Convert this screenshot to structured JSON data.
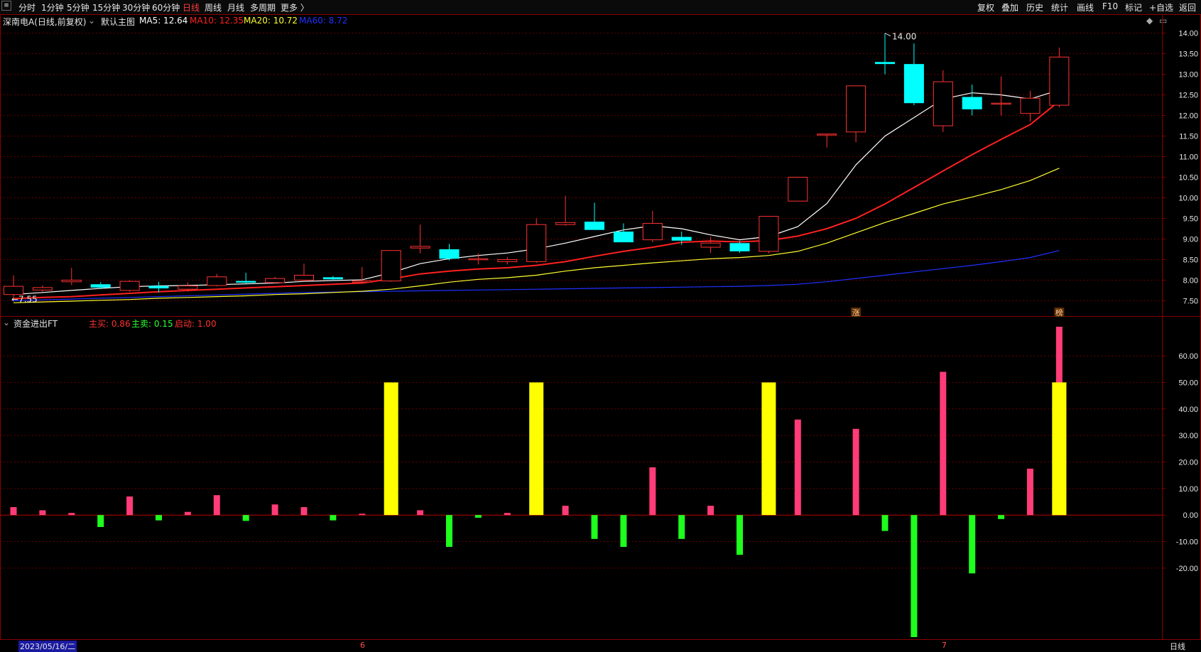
{
  "toolbar": {
    "left": [
      "分时",
      "1分钟",
      "5分钟",
      "15分钟",
      "30分钟",
      "60分钟",
      "日线",
      "周线",
      "月线",
      "多周期",
      "更多 〉"
    ],
    "active": "日线",
    "right": [
      "复权",
      "叠加",
      "历史",
      "统计",
      "画线",
      "F10",
      "标记",
      "+自选",
      "返回"
    ]
  },
  "price_panel": {
    "title": "深南电A(日线,前复权)",
    "main_indicator": "默认主图",
    "ma_labels": [
      {
        "name": "MA5",
        "text": "MA5: 12.64",
        "color": "#ffffff"
      },
      {
        "name": "MA10",
        "text": "MA10: 12.35",
        "color": "#ff2020"
      },
      {
        "name": "MA20",
        "text": "MA20: 10.72",
        "color": "#ffff30"
      },
      {
        "name": "MA60",
        "text": "MA60: 8.72",
        "color": "#2030ff"
      }
    ],
    "high_annotation": "14.00",
    "low_annotation": "←7.55",
    "badges": [
      "涨",
      "榜"
    ]
  },
  "indicator_panel": {
    "title": "资金进出FT",
    "labels": [
      {
        "text": "主买: 0.86",
        "color": "#ff3030"
      },
      {
        "text": "主卖: 0.15",
        "color": "#30ff30"
      },
      {
        "text": "启动: 1.00",
        "color": "#ff3030"
      }
    ]
  },
  "footer": {
    "date_label": "2023/05/16/二",
    "month_markers": [
      "6",
      "7"
    ],
    "period_label": "日线"
  },
  "colors": {
    "up": "#ff3232",
    "down": "#00ffff",
    "ma5": "#ffffff",
    "ma10": "#ff2020",
    "ma20": "#ffff30",
    "ma60": "#2030ff",
    "buy": "#ff3c78",
    "sell": "#1eff1e",
    "start": "#ffff00"
  },
  "chart_data": [
    {
      "type": "candlestick",
      "y_ticks": [
        7.5,
        8.0,
        8.5,
        9.0,
        9.5,
        10.0,
        10.5,
        11.0,
        11.5,
        12.0,
        12.5,
        13.0,
        13.5,
        14.0
      ],
      "ylim": [
        7.3,
        14.15
      ],
      "candles": [
        {
          "o": 7.65,
          "h": 8.12,
          "l": 7.58,
          "c": 7.85
        },
        {
          "o": 7.76,
          "h": 7.87,
          "l": 7.72,
          "c": 7.82
        },
        {
          "o": 7.96,
          "h": 8.3,
          "l": 7.88,
          "c": 8.0
        },
        {
          "o": 7.9,
          "h": 7.95,
          "l": 7.78,
          "c": 7.82
        },
        {
          "o": 7.75,
          "h": 8.0,
          "l": 7.72,
          "c": 7.97
        },
        {
          "o": 7.86,
          "h": 7.96,
          "l": 7.7,
          "c": 7.8
        },
        {
          "o": 7.78,
          "h": 7.95,
          "l": 7.72,
          "c": 7.86
        },
        {
          "o": 7.87,
          "h": 8.15,
          "l": 7.85,
          "c": 8.08
        },
        {
          "o": 7.98,
          "h": 8.18,
          "l": 7.9,
          "c": 7.94
        },
        {
          "o": 7.94,
          "h": 8.08,
          "l": 7.92,
          "c": 8.04
        },
        {
          "o": 8.0,
          "h": 8.4,
          "l": 7.97,
          "c": 8.12
        },
        {
          "o": 8.07,
          "h": 8.1,
          "l": 7.98,
          "c": 8.02
        },
        {
          "o": 7.95,
          "h": 8.32,
          "l": 7.93,
          "c": 7.98
        },
        {
          "o": 7.98,
          "h": 8.72,
          "l": 7.96,
          "c": 8.72
        },
        {
          "o": 8.78,
          "h": 9.35,
          "l": 8.65,
          "c": 8.82
        },
        {
          "o": 8.75,
          "h": 8.88,
          "l": 8.48,
          "c": 8.52
        },
        {
          "o": 8.52,
          "h": 8.65,
          "l": 8.38,
          "c": 8.52
        },
        {
          "o": 8.45,
          "h": 8.56,
          "l": 8.38,
          "c": 8.5
        },
        {
          "o": 8.45,
          "h": 9.5,
          "l": 8.42,
          "c": 9.35
        },
        {
          "o": 9.35,
          "h": 10.05,
          "l": 9.32,
          "c": 9.4
        },
        {
          "o": 9.42,
          "h": 9.88,
          "l": 9.22,
          "c": 9.22
        },
        {
          "o": 9.18,
          "h": 9.38,
          "l": 8.92,
          "c": 8.92
        },
        {
          "o": 8.98,
          "h": 9.68,
          "l": 8.92,
          "c": 9.38
        },
        {
          "o": 9.05,
          "h": 9.18,
          "l": 8.86,
          "c": 8.96
        },
        {
          "o": 8.8,
          "h": 9.05,
          "l": 8.66,
          "c": 8.9
        },
        {
          "o": 8.9,
          "h": 8.95,
          "l": 8.66,
          "c": 8.7
        },
        {
          "o": 8.7,
          "h": 9.55,
          "l": 8.65,
          "c": 9.55
        },
        {
          "o": 9.92,
          "h": 10.5,
          "l": 9.92,
          "c": 10.5
        },
        {
          "o": 11.55,
          "h": 11.55,
          "l": 11.22,
          "c": 11.55
        },
        {
          "o": 11.6,
          "h": 12.72,
          "l": 11.35,
          "c": 12.72
        },
        {
          "o": 13.3,
          "h": 14.0,
          "l": 13.0,
          "c": 13.25
        },
        {
          "o": 13.25,
          "h": 13.75,
          "l": 12.25,
          "c": 12.3
        },
        {
          "o": 11.75,
          "h": 13.1,
          "l": 11.6,
          "c": 12.82
        },
        {
          "o": 12.45,
          "h": 12.75,
          "l": 12.0,
          "c": 12.15
        },
        {
          "o": 12.3,
          "h": 12.95,
          "l": 12.0,
          "c": 12.3
        },
        {
          "o": 12.05,
          "h": 12.6,
          "l": 11.85,
          "c": 12.42
        },
        {
          "o": 12.25,
          "h": 13.65,
          "l": 12.2,
          "c": 13.42
        }
      ],
      "ma5": [
        7.65,
        7.7,
        7.75,
        7.8,
        7.84,
        7.86,
        7.87,
        7.89,
        7.91,
        7.93,
        7.97,
        7.99,
        8.01,
        8.18,
        8.4,
        8.52,
        8.6,
        8.66,
        8.76,
        8.9,
        9.06,
        9.22,
        9.32,
        9.25,
        9.1,
        8.98,
        9.06,
        9.3,
        9.86,
        10.8,
        11.5,
        11.95,
        12.4,
        12.55,
        12.5,
        12.4,
        12.62
      ],
      "ma10": [
        7.55,
        7.58,
        7.6,
        7.64,
        7.68,
        7.72,
        7.75,
        7.78,
        7.81,
        7.84,
        7.87,
        7.9,
        7.93,
        8.03,
        8.15,
        8.22,
        8.27,
        8.3,
        8.36,
        8.45,
        8.58,
        8.7,
        8.8,
        8.92,
        8.95,
        8.93,
        8.96,
        9.07,
        9.25,
        9.5,
        9.85,
        10.25,
        10.65,
        11.05,
        11.42,
        11.78,
        12.35
      ],
      "ma20": [
        7.45,
        7.47,
        7.49,
        7.51,
        7.53,
        7.56,
        7.58,
        7.6,
        7.62,
        7.65,
        7.67,
        7.7,
        7.73,
        7.78,
        7.86,
        7.95,
        8.02,
        8.06,
        8.12,
        8.22,
        8.3,
        8.36,
        8.42,
        8.47,
        8.52,
        8.55,
        8.6,
        8.7,
        8.9,
        9.15,
        9.4,
        9.62,
        9.85,
        10.02,
        10.2,
        10.42,
        10.72
      ],
      "ma60": [
        7.5,
        7.52,
        7.54,
        7.56,
        7.58,
        7.6,
        7.62,
        7.64,
        7.66,
        7.68,
        7.7,
        7.71,
        7.72,
        7.73,
        7.74,
        7.75,
        7.76,
        7.77,
        7.78,
        7.79,
        7.8,
        7.81,
        7.82,
        7.83,
        7.84,
        7.85,
        7.87,
        7.9,
        7.96,
        8.04,
        8.12,
        8.2,
        8.28,
        8.36,
        8.45,
        8.55,
        8.72
      ]
    },
    {
      "type": "bar",
      "y_ticks": [
        60,
        50,
        40,
        30,
        20,
        10,
        0,
        -10,
        -20
      ],
      "ylim": [
        -46,
        71
      ],
      "values": [
        3,
        1.8,
        0.8,
        -4.5,
        7,
        -2,
        1.2,
        7.5,
        -2.2,
        4,
        3,
        -2,
        0.5,
        0,
        1.8,
        -12,
        -1,
        0.8,
        0,
        3.5,
        -9,
        -12,
        18,
        -9,
        3.5,
        -15,
        0,
        36,
        0,
        32.5,
        -6,
        -46,
        54,
        -22,
        -1.5,
        17.5,
        71
      ],
      "start_signals": [
        {
          "index": 13,
          "value": 50
        },
        {
          "index": 18,
          "value": 50
        },
        {
          "index": 26,
          "value": 50
        },
        {
          "index": 36,
          "value": 50
        }
      ]
    }
  ]
}
